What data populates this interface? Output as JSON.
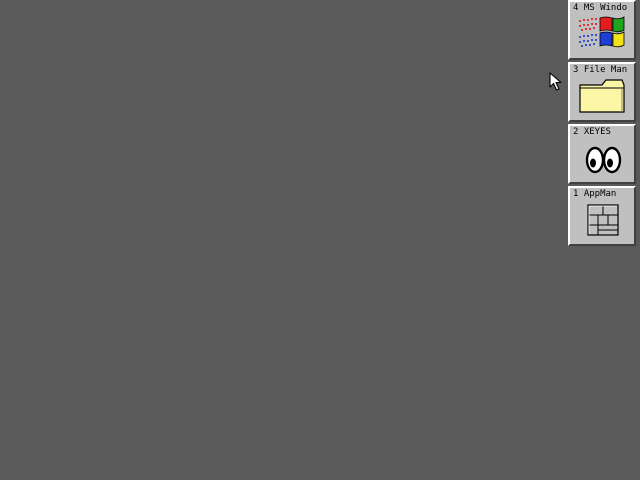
{
  "desktop": {
    "background_color": "#5a5a5a"
  },
  "dock": {
    "items": [
      {
        "label": "4 MS Windo",
        "icon": "windows-logo-icon"
      },
      {
        "label": "3 File Man",
        "icon": "folder-icon"
      },
      {
        "label": "2 XEYES",
        "icon": "eyes-icon"
      },
      {
        "label": "1 AppMan",
        "icon": "app-manager-icon"
      }
    ]
  },
  "colors": {
    "tile_face": "#c0c0c0",
    "bevel_light": "#ffffff",
    "bevel_dark": "#404040",
    "win_red": "#e21d1d",
    "win_green": "#1ea51e",
    "win_blue": "#1d3fd6",
    "win_yellow": "#f2e21a",
    "folder_fill": "#fbf5a6"
  },
  "cursor": {
    "icon": "arrow-cursor-icon"
  }
}
